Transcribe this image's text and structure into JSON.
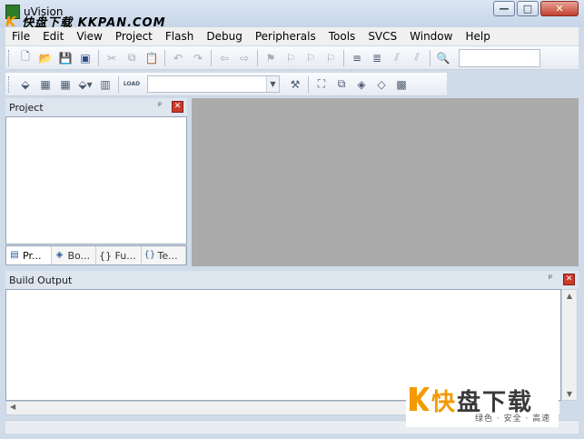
{
  "window": {
    "title": "uVision",
    "minimize_glyph": "—",
    "maximize_glyph": "□",
    "close_glyph": "✕"
  },
  "watermark": {
    "top_logo_char": "K",
    "top_text": "快盘下载 KKPAN.COM",
    "bottom_cn_first": "快",
    "bottom_cn_rest": "盘下载",
    "bottom_sub": "绿色 · 安全 · 高速",
    "accent_color": "#f49a00"
  },
  "menu": {
    "items": [
      "File",
      "Edit",
      "View",
      "Project",
      "Flash",
      "Debug",
      "Peripherals",
      "Tools",
      "SVCS",
      "Window",
      "Help"
    ]
  },
  "toolbar1": {
    "icons": [
      "new-file-icon",
      "open-file-icon",
      "save-icon",
      "save-all-icon",
      "cut-icon",
      "copy-icon",
      "paste-icon",
      "undo-icon",
      "redo-icon",
      "nav-back-icon",
      "nav-forward-icon",
      "bookmark-icon",
      "prev-bookmark-icon",
      "next-bookmark-icon",
      "clear-bookmarks-icon",
      "indent-icon",
      "unindent-icon",
      "comment-icon",
      "uncomment-icon",
      "find-in-files-icon"
    ]
  },
  "toolbar2": {
    "icons": [
      "translate-icon",
      "build-icon",
      "rebuild-icon",
      "batch-build-icon",
      "stop-build-icon",
      "download-icon",
      "target-options-icon",
      "manage-components-icon",
      "select-packs-icon",
      "pack-installer-icon",
      "run-time-env-icon",
      "books-icon"
    ],
    "download_label": "LOAD"
  },
  "project_panel": {
    "title": "Project",
    "pin_glyph": "ᵖ",
    "close_glyph": "✕",
    "tabs": [
      {
        "label": "Pr...",
        "icon": "project-tab-icon"
      },
      {
        "label": "Bo...",
        "icon": "books-tab-icon"
      },
      {
        "label": "{} Fu...",
        "icon": "functions-tab-icon"
      },
      {
        "label": "Te...",
        "icon": "templates-tab-icon"
      }
    ]
  },
  "output_panel": {
    "title": "Build Output",
    "pin_glyph": "ᵖ",
    "close_glyph": "✕"
  },
  "colors": {
    "editor_bg": "#ababab",
    "titlebar": "#c6d5e8",
    "close_red": "#c93a2b"
  }
}
